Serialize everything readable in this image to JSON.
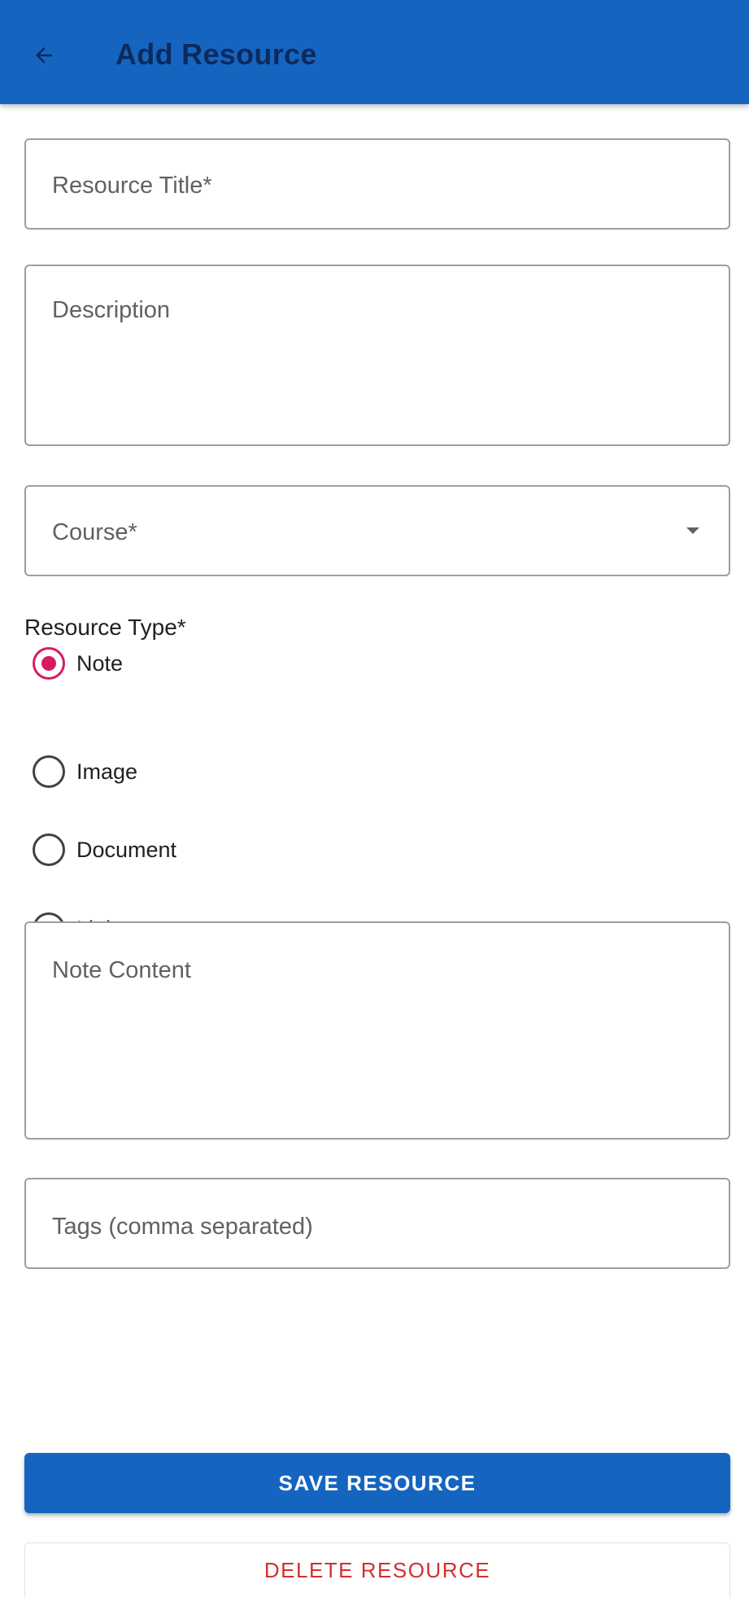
{
  "app_bar": {
    "title": "Add Resource",
    "back_icon": "arrow-left-icon",
    "color": "#1565c0"
  },
  "form": {
    "title_field": {
      "placeholder": "Resource Title*",
      "value": ""
    },
    "description_field": {
      "placeholder": "Description",
      "value": ""
    },
    "course_field": {
      "placeholder": "Course*",
      "value": "",
      "icon": "dropdown-caret-icon"
    },
    "resource_type": {
      "label": "Resource Type*",
      "options": [
        {
          "label": "Note",
          "selected": true
        },
        {
          "label": "Image",
          "selected": false
        },
        {
          "label": "Document",
          "selected": false
        },
        {
          "label": "Link",
          "selected": false
        }
      ],
      "selected_color": "#d81b60"
    },
    "note_content_field": {
      "placeholder": "Note Content",
      "value": ""
    },
    "tags_field": {
      "placeholder": "Tags (comma separated)",
      "value": ""
    }
  },
  "actions": {
    "save_label": "SAVE RESOURCE",
    "delete_label": "DELETE RESOURCE",
    "save_color": "#1565c0",
    "delete_color": "#d32f2f"
  }
}
